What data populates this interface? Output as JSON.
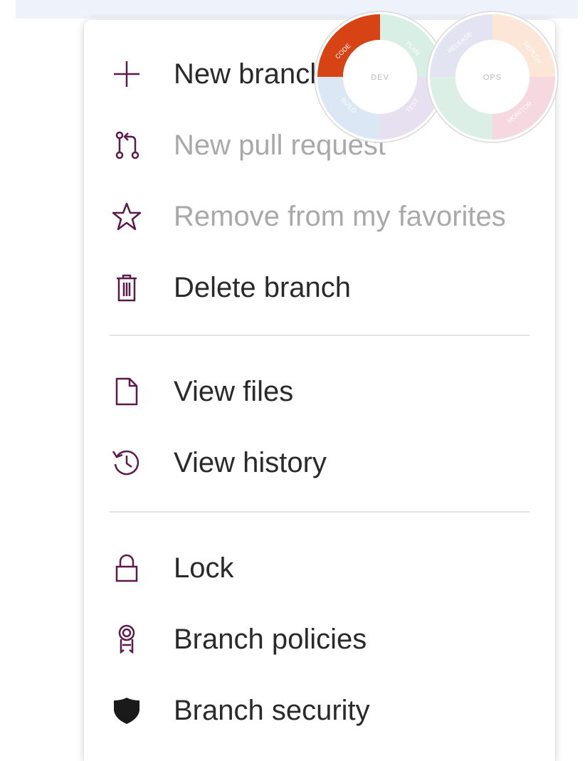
{
  "menu": {
    "items": [
      {
        "label": "New branch",
        "icon": "plus-icon",
        "enabled": true
      },
      {
        "label": "New pull request",
        "icon": "pull-request-icon",
        "enabled": false
      },
      {
        "label": "Remove from my favorites",
        "icon": "star-icon",
        "enabled": false
      },
      {
        "label": "Delete branch",
        "icon": "trash-icon",
        "enabled": true
      },
      {
        "label": "View files",
        "icon": "file-icon",
        "enabled": true
      },
      {
        "label": "View history",
        "icon": "history-icon",
        "enabled": true
      },
      {
        "label": "Lock",
        "icon": "lock-icon",
        "enabled": true
      },
      {
        "label": "Branch policies",
        "icon": "policy-badge-icon",
        "enabled": true
      },
      {
        "label": "Branch security",
        "icon": "shield-icon",
        "enabled": true
      }
    ]
  },
  "logo": {
    "left_ring": {
      "center": "DEV",
      "segments": [
        "CODE",
        "PLAN",
        "BUILD",
        "TEST"
      ]
    },
    "right_ring": {
      "center": "OPS",
      "segments": [
        "RELEASE",
        "DEPLOY",
        "MONITOR"
      ]
    }
  },
  "colors": {
    "icon": "#5c1a4a",
    "text": "#2a2a2a",
    "disabled_text": "#a9a9a9",
    "code_segment": "#d84315"
  }
}
